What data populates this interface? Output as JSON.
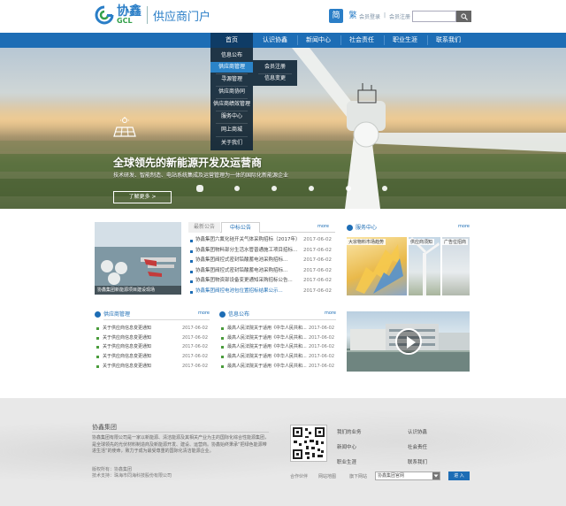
{
  "header": {
    "logo_cn": "协鑫",
    "logo_en": "GCL",
    "portal": "供应商门户",
    "lang_simplified": "简",
    "lang_traditional": "繁",
    "login": "会员登录",
    "register": "会员注册",
    "search_placeholder": ""
  },
  "nav": {
    "items": [
      {
        "label": "首页"
      },
      {
        "label": "认识协鑫"
      },
      {
        "label": "新闻中心"
      },
      {
        "label": "社会责任"
      },
      {
        "label": "职业生涯"
      },
      {
        "label": "联系我们"
      }
    ]
  },
  "dropdown_main": {
    "items": [
      {
        "label": "信息公布"
      },
      {
        "label": "供应商管理"
      },
      {
        "label": "寻源管理"
      },
      {
        "label": "供应商协同"
      },
      {
        "label": "供应商绩效管理"
      },
      {
        "label": "服务中心"
      },
      {
        "label": "网上商城"
      },
      {
        "label": "关于我们"
      }
    ]
  },
  "dropdown_sub": {
    "items": [
      {
        "label": "会员注册"
      },
      {
        "label": "信息变更"
      }
    ]
  },
  "banner": {
    "title": "全球领先的新能源开发及运营商",
    "subtitle": "技术研发、智能制造、电站系统集成及运营管理为一体的国际化新能源企业",
    "more": "了解更多 >"
  },
  "news": {
    "tab_inactive": "最新公告",
    "tab_active": "中标公告",
    "more": "more",
    "photo_caption": "协鑫集团新能源项目建设现场",
    "rows": [
      {
        "title": "协鑫集团六氟化硅开关气体采购招标（2017年）",
        "date": "2017-06-02"
      },
      {
        "title": "协鑫集团物料部分生活水管普通施工项目招标...",
        "date": "2017-06-02"
      },
      {
        "title": "协鑫集团阀控式密封铅酸蓄电池采购招标...",
        "date": "2017-06-02"
      },
      {
        "title": "协鑫集团阀控式密封铅酸蓄电池采购招标...",
        "date": "2017-06-02"
      },
      {
        "title": "协鑫集团物资部设备变更通知采购招标公告...",
        "date": "2017-06-02"
      },
      {
        "title": "协鑫集团阀控电池包位置招标结果公示...",
        "date": "2017-06-02"
      }
    ]
  },
  "service": {
    "title": "服务中心",
    "more": "more",
    "tiles": [
      {
        "label": "大宗物料市场趋势"
      },
      {
        "label": "供应商须知"
      },
      {
        "label": "广告位招商"
      }
    ]
  },
  "supplier_mgmt": {
    "title": "供应商管理",
    "more": "more",
    "rows": [
      {
        "title": "关于供应商信息变更通知",
        "date": "2017-06-02"
      },
      {
        "title": "关于供应商信息变更通知",
        "date": "2017-06-02"
      },
      {
        "title": "关于供应商信息变更通知",
        "date": "2017-06-02"
      },
      {
        "title": "关于供应商信息变更通知",
        "date": "2017-06-02"
      },
      {
        "title": "关于供应商信息变更通知",
        "date": "2017-06-02"
      }
    ]
  },
  "info_release": {
    "title": "信息公布",
    "more": "more",
    "rows": [
      {
        "title": "最高人民法院关于适用《中华人民共和...",
        "date": "2017-06-02"
      },
      {
        "title": "最高人民法院关于适用《中华人民共和...",
        "date": "2017-06-02"
      },
      {
        "title": "最高人民法院关于适用《中华人民共和...",
        "date": "2017-06-02"
      },
      {
        "title": "最高人民法院关于适用《中华人民共和...",
        "date": "2017-06-02"
      },
      {
        "title": "最高人民法院关于适用《中华人民共和...",
        "date": "2017-06-02"
      }
    ]
  },
  "footer": {
    "title": "协鑫集团",
    "desc": "协鑫集团有限公司是一家以新能源、清洁能源及其相关产业为主的国际化综合性能源集团，是全球领先的光伏材料制造商及新能源开发、建设、运营商。协鑫始终秉承“把绿色能源带进生活”的使命，致力于成为最受尊重的国际化清洁能源企业。",
    "copy1": "版权所有：协鑫集团",
    "copy2": "技术支持：珠海市同海科技股份有限公司",
    "links": [
      {
        "label": "我们的业务"
      },
      {
        "label": "认识协鑫"
      },
      {
        "label": "新闻中心"
      },
      {
        "label": "社会责任"
      },
      {
        "label": "职业生涯"
      },
      {
        "label": "联系我们"
      }
    ],
    "partner": "合作伙伴",
    "site_nav": "网站地图",
    "group_sites": "旗下网站",
    "select_value": "协鑫集团官网",
    "enter": "进 入"
  }
}
